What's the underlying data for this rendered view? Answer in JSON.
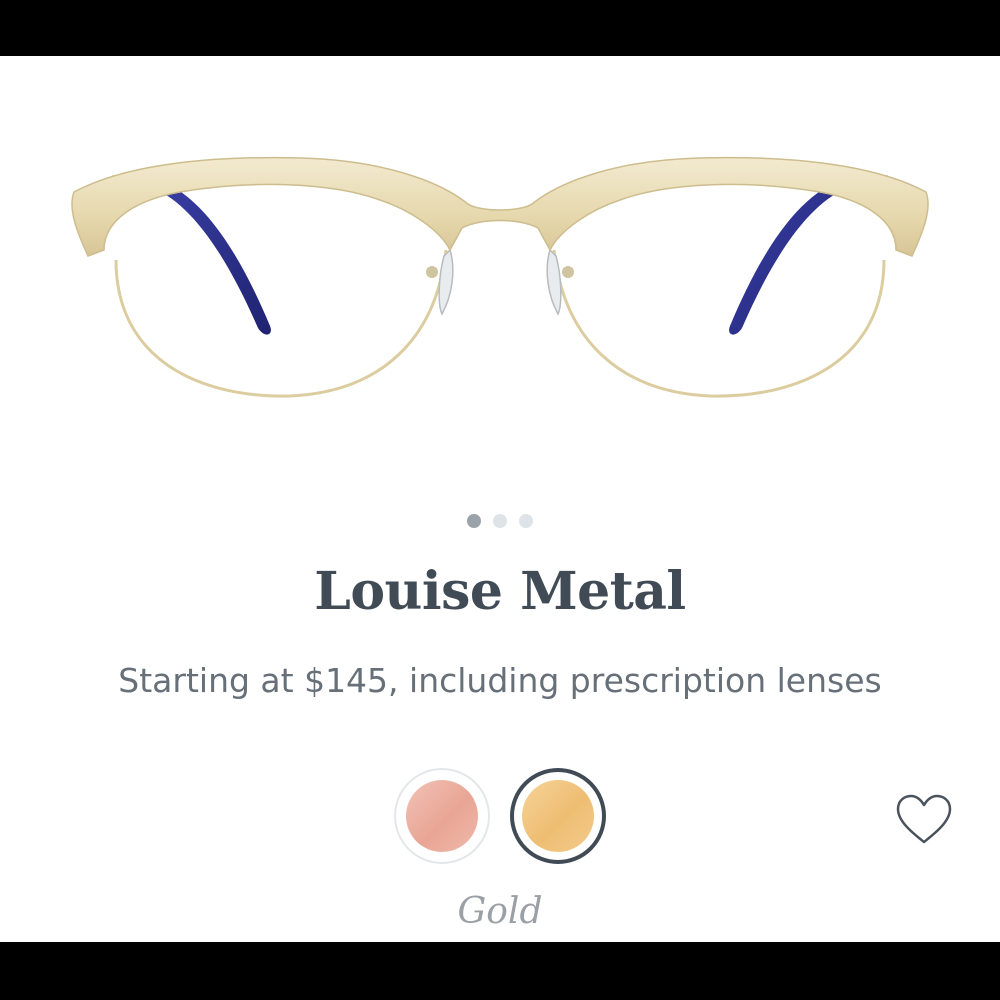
{
  "product": {
    "name": "Louise Metal",
    "price_line": "Starting at $145, including prescription lenses"
  },
  "carousel": {
    "count": 3,
    "active_index": 0
  },
  "colors": {
    "options": [
      {
        "name": "rose-gold-swatch",
        "hex": "#e8a595"
      },
      {
        "name": "gold-swatch",
        "hex": "#eebd72"
      }
    ],
    "selected_label": "Gold"
  },
  "icons": {
    "favorite": "heart-outline-icon"
  },
  "theme": {
    "title_color": "#414b56",
    "text_color": "#677079",
    "frame_gold": "#e9dcb3",
    "temple_blue": "#2a2f8a"
  }
}
